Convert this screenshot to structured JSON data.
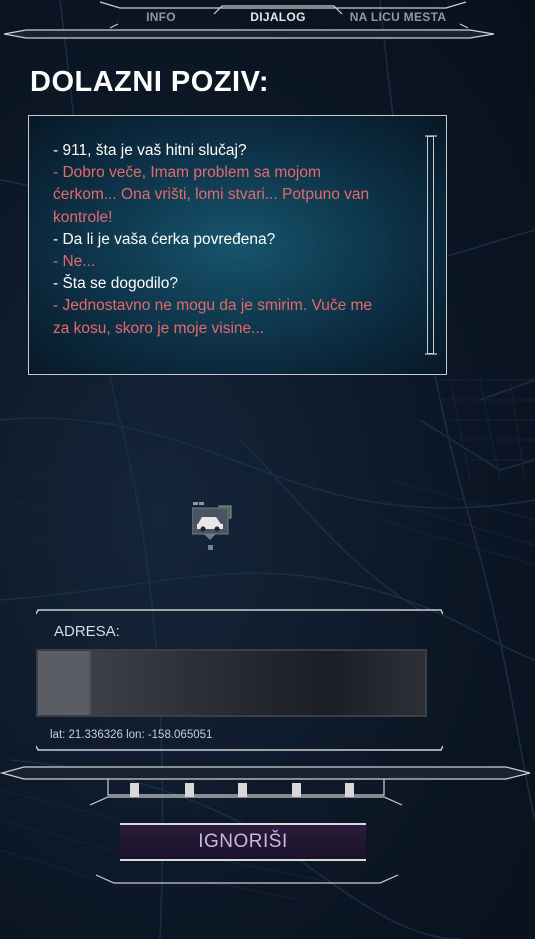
{
  "tabs": [
    {
      "label": "INFO",
      "active": false
    },
    {
      "label": "DIJALOG",
      "active": true
    },
    {
      "label": "NA LICU MESTA",
      "active": false
    }
  ],
  "title": "DOLAZNI POZIV:",
  "dialog": [
    {
      "speaker": "operator",
      "text": "- 911, šta je vaš hitni slučaj?"
    },
    {
      "speaker": "caller",
      "text": "- Dobro veče, Imam problem sa mojom"
    },
    {
      "speaker": "caller",
      "text": "ćerkom... Ona vrišti, lomi stvari... Potpuno van"
    },
    {
      "speaker": "caller",
      "text": "kontrole!"
    },
    {
      "speaker": "operator",
      "text": "- Da li je vaša ćerka povređena?"
    },
    {
      "speaker": "caller",
      "text": "- Ne..."
    },
    {
      "speaker": "operator",
      "text": "- Šta se dogodilo?"
    },
    {
      "speaker": "caller",
      "text": "- Jednostavno ne mogu da je smirim. Vuče me"
    },
    {
      "speaker": "caller",
      "text": "za kosu, skoro je moje visine..."
    }
  ],
  "address": {
    "label": "ADRESA:",
    "value": "",
    "coords": "lat: 21.336326 lon: -158.065051"
  },
  "actions": {
    "ignore_label": "IGNORIŠI"
  },
  "colors": {
    "operator_text": "#ffffff",
    "caller_text": "#e46a6a",
    "button_text": "#c7b6e6"
  },
  "icons": {
    "map_marker": "police-car-icon"
  }
}
